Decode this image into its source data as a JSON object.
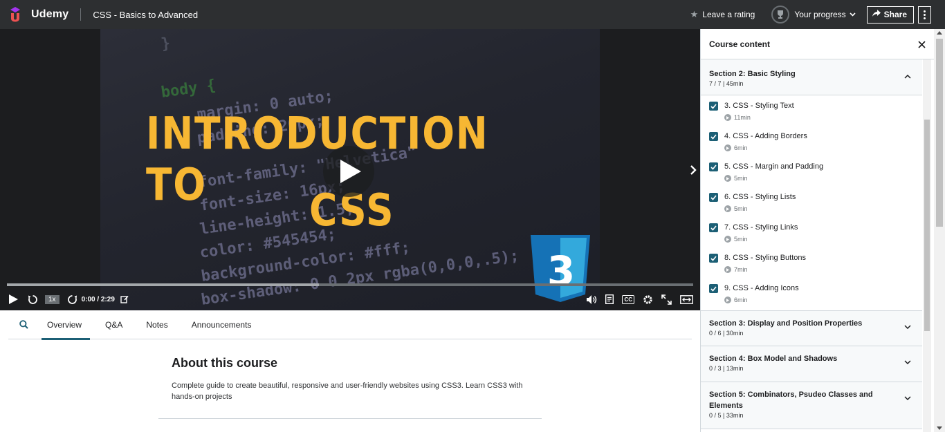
{
  "header": {
    "logo_text": "Udemy",
    "course_title": "CSS - Basics to Advanced",
    "rating_label": "Leave a rating",
    "progress_label": "Your progress",
    "share_label": "Share"
  },
  "video": {
    "title_line1": "INTRODUCTION  TO",
    "title_line2": "CSS",
    "badge_number": "3",
    "code_lines": [
      "}",
      "body {",
      "margin: 0 auto;",
      "padding: 20px;",
      "font-family: \"Helvetica\"",
      "font-size: 16px;",
      "line-height: 1.5;",
      "color: #545454;",
      "background-color: #fff;",
      "box-shadow: 0 0 2px rgba(0,0,0,.5);"
    ],
    "speed": "1x",
    "time": "0:00 / 2:29",
    "buffered_fraction": 0.455,
    "cc_label": "CC"
  },
  "tabs": [
    "Overview",
    "Q&A",
    "Notes",
    "Announcements"
  ],
  "about": {
    "title": "About this course",
    "description": "Complete guide to create beautiful, responsive and user-friendly websites using CSS3. Learn CSS3 with hands-on projects"
  },
  "sidebar": {
    "title": "Course content",
    "sections": [
      {
        "title": "Section 2: Basic Styling",
        "meta": "7 / 7 | 45min",
        "expanded": true,
        "lectures": [
          {
            "title": "3. CSS - Styling Text",
            "duration": "11min"
          },
          {
            "title": "4. CSS - Adding Borders",
            "duration": "6min"
          },
          {
            "title": "5. CSS - Margin and Padding",
            "duration": "5min"
          },
          {
            "title": "6. CSS - Styling Lists",
            "duration": "5min"
          },
          {
            "title": "7. CSS - Styling Links",
            "duration": "5min"
          },
          {
            "title": "8. CSS - Styling Buttons",
            "duration": "7min"
          },
          {
            "title": "9. CSS - Adding Icons",
            "duration": "6min"
          }
        ]
      },
      {
        "title": "Section 3: Display and Position Properties",
        "meta": "0 / 6 | 30min",
        "expanded": false
      },
      {
        "title": "Section 4: Box Model and Shadows",
        "meta": "0 / 3 | 13min",
        "expanded": false
      },
      {
        "title": "Section 5: Combinators, Psudeo Classes and Elements",
        "meta": "0 / 5 | 33min",
        "expanded": false
      }
    ]
  },
  "colors": {
    "header_bg": "#2d2f31",
    "brand": "#a435f0",
    "accent": "#1c5f75",
    "title_yellow": "#f7b733",
    "css3_blue": "#1572b6"
  }
}
